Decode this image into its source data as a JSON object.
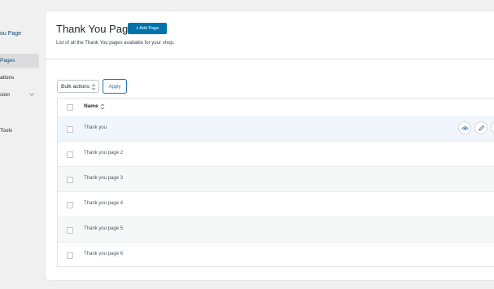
{
  "sidebar": {
    "title": "ou Page",
    "items": [
      {
        "label": "Pages"
      },
      {
        "label": "ations"
      },
      {
        "label": "sion"
      },
      {
        "label": "Tools"
      }
    ]
  },
  "header": {
    "title": "Thank You Pages",
    "add_label": "+ Add Page",
    "subtitle": "List of all the Thank You pages available for your shop."
  },
  "bulk": {
    "select_value": "Bulk actions",
    "apply_label": "Apply"
  },
  "table": {
    "column_name": "Name",
    "rows": [
      {
        "name": "Thank you"
      },
      {
        "name": "Thank you page 2"
      },
      {
        "name": "Thank you page 3"
      },
      {
        "name": "Thank you page 4"
      },
      {
        "name": "Thank you page 5"
      },
      {
        "name": "Thank you page 6"
      }
    ],
    "row_actions": [
      "eye-icon",
      "pencil-icon",
      "copy-icon"
    ]
  },
  "colors": {
    "accent": "#0073aa",
    "link": "#2271b1"
  }
}
